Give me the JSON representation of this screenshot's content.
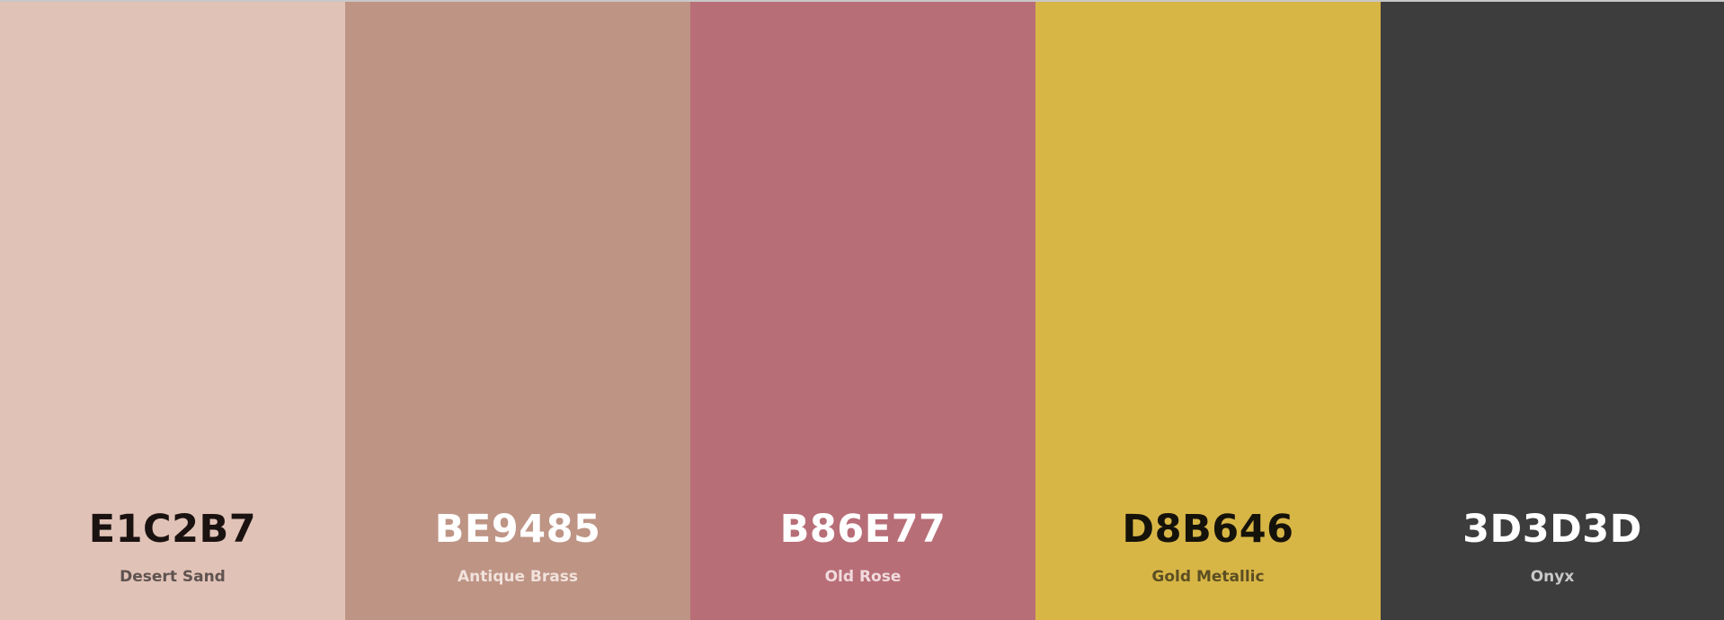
{
  "palette": {
    "colors": [
      {
        "hex": "E1C2B7",
        "name": "Desert Sand",
        "bg": "#E1C2B7",
        "hex_color": "#1a1210",
        "name_color": "#5f5350"
      },
      {
        "hex": "BE9485",
        "name": "Antique Brass",
        "bg": "#BE9485",
        "hex_color": "#ffffff",
        "name_color": "#f1e2dc"
      },
      {
        "hex": "B86E77",
        "name": "Old Rose",
        "bg": "#B86E77",
        "hex_color": "#ffffff",
        "name_color": "#f1dbdd"
      },
      {
        "hex": "D8B646",
        "name": "Gold Metallic",
        "bg": "#D8B646",
        "hex_color": "#15120a",
        "name_color": "#5c4e22"
      },
      {
        "hex": "3D3D3D",
        "name": "Onyx",
        "bg": "#3D3D3D",
        "hex_color": "#ffffff",
        "name_color": "#c8c8c8"
      }
    ]
  }
}
